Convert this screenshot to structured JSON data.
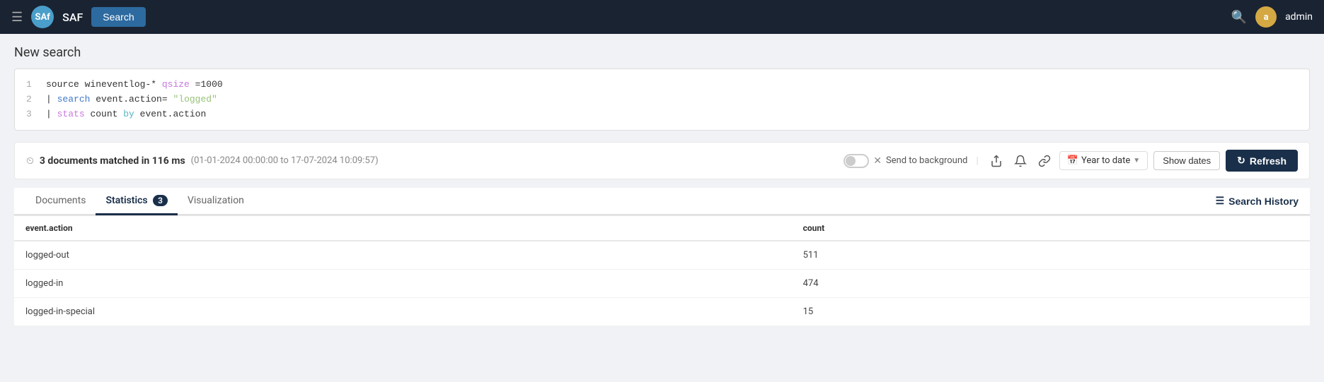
{
  "navbar": {
    "hamburger_icon": "☰",
    "logo_text": "SAf",
    "app_name": "SAF",
    "search_button_label": "Search",
    "search_icon": "🔍",
    "avatar_letter": "a",
    "username": "admin"
  },
  "page": {
    "title": "New search"
  },
  "query_editor": {
    "lines": [
      {
        "num": "1",
        "content": "source wineventlog-* qsize=1000"
      },
      {
        "num": "2",
        "content": "| search event.action=\"logged\""
      },
      {
        "num": "3",
        "content": "| stats count by event.action"
      }
    ]
  },
  "toolbar": {
    "match_count": "3 documents matched in 116 ms",
    "match_range": "(01-01-2024 00:00:00 to 17-07-2024 10:09:57)",
    "send_to_background_label": "Send to background",
    "date_preset_label": "Year to date",
    "show_dates_label": "Show dates",
    "refresh_label": "Refresh",
    "clock_icon": "⏱",
    "share_icon": "⬆",
    "bell_icon": "🔔",
    "link_icon": "🔗",
    "calendar_icon": "📅",
    "refresh_spin_icon": "↺"
  },
  "tabs": [
    {
      "id": "documents",
      "label": "Documents",
      "badge": null,
      "active": false
    },
    {
      "id": "statistics",
      "label": "Statistics",
      "badge": "3",
      "active": true
    },
    {
      "id": "visualization",
      "label": "Visualization",
      "badge": null,
      "active": false
    }
  ],
  "search_history_button": "Search History",
  "table": {
    "columns": [
      {
        "id": "event_action",
        "label": "event.action"
      },
      {
        "id": "count",
        "label": "count"
      }
    ],
    "rows": [
      {
        "event_action": "logged-out",
        "count": "511"
      },
      {
        "event_action": "logged-in",
        "count": "474"
      },
      {
        "event_action": "logged-in-special",
        "count": "15"
      }
    ]
  }
}
